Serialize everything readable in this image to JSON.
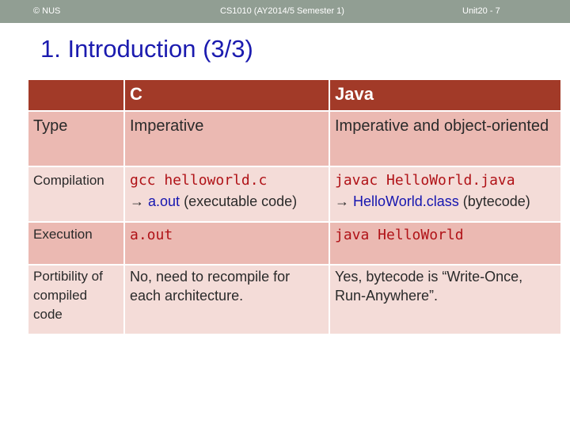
{
  "header": {
    "left": "© NUS",
    "center": "CS1010 (AY2014/5 Semester 1)",
    "right": "Unit20 - 7"
  },
  "title": "1. Introduction (3/3)",
  "table": {
    "columns": [
      "",
      "C",
      "Java"
    ],
    "rows": {
      "type": {
        "label": "Type",
        "c": "Imperative",
        "java": "Imperative and object-oriented"
      },
      "compilation": {
        "label": "Compilation",
        "c_command": "gcc helloworld.c",
        "c_arrow": "→",
        "c_output": "a.out",
        "c_output_note": "(executable code)",
        "java_command": "javac HelloWorld.java",
        "java_arrow": "→",
        "java_output": "HelloWorld.class",
        "java_output_note": "(bytecode)"
      },
      "execution": {
        "label": "Execution",
        "c": "a.out",
        "java": "java HelloWorld"
      },
      "portability": {
        "label": "Portibility of compiled code",
        "c": "No, need to recompile for each architecture.",
        "java": "Yes, bytecode is “Write-Once, Run-Anywhere”."
      }
    }
  },
  "colors": {
    "header_bar": "#919e93",
    "title": "#1b1baf",
    "table_header": "#a23a28",
    "row_dark": "#ebb9b2",
    "row_light": "#f4dcd8",
    "code": "#b01217",
    "link": "#1616b0"
  }
}
